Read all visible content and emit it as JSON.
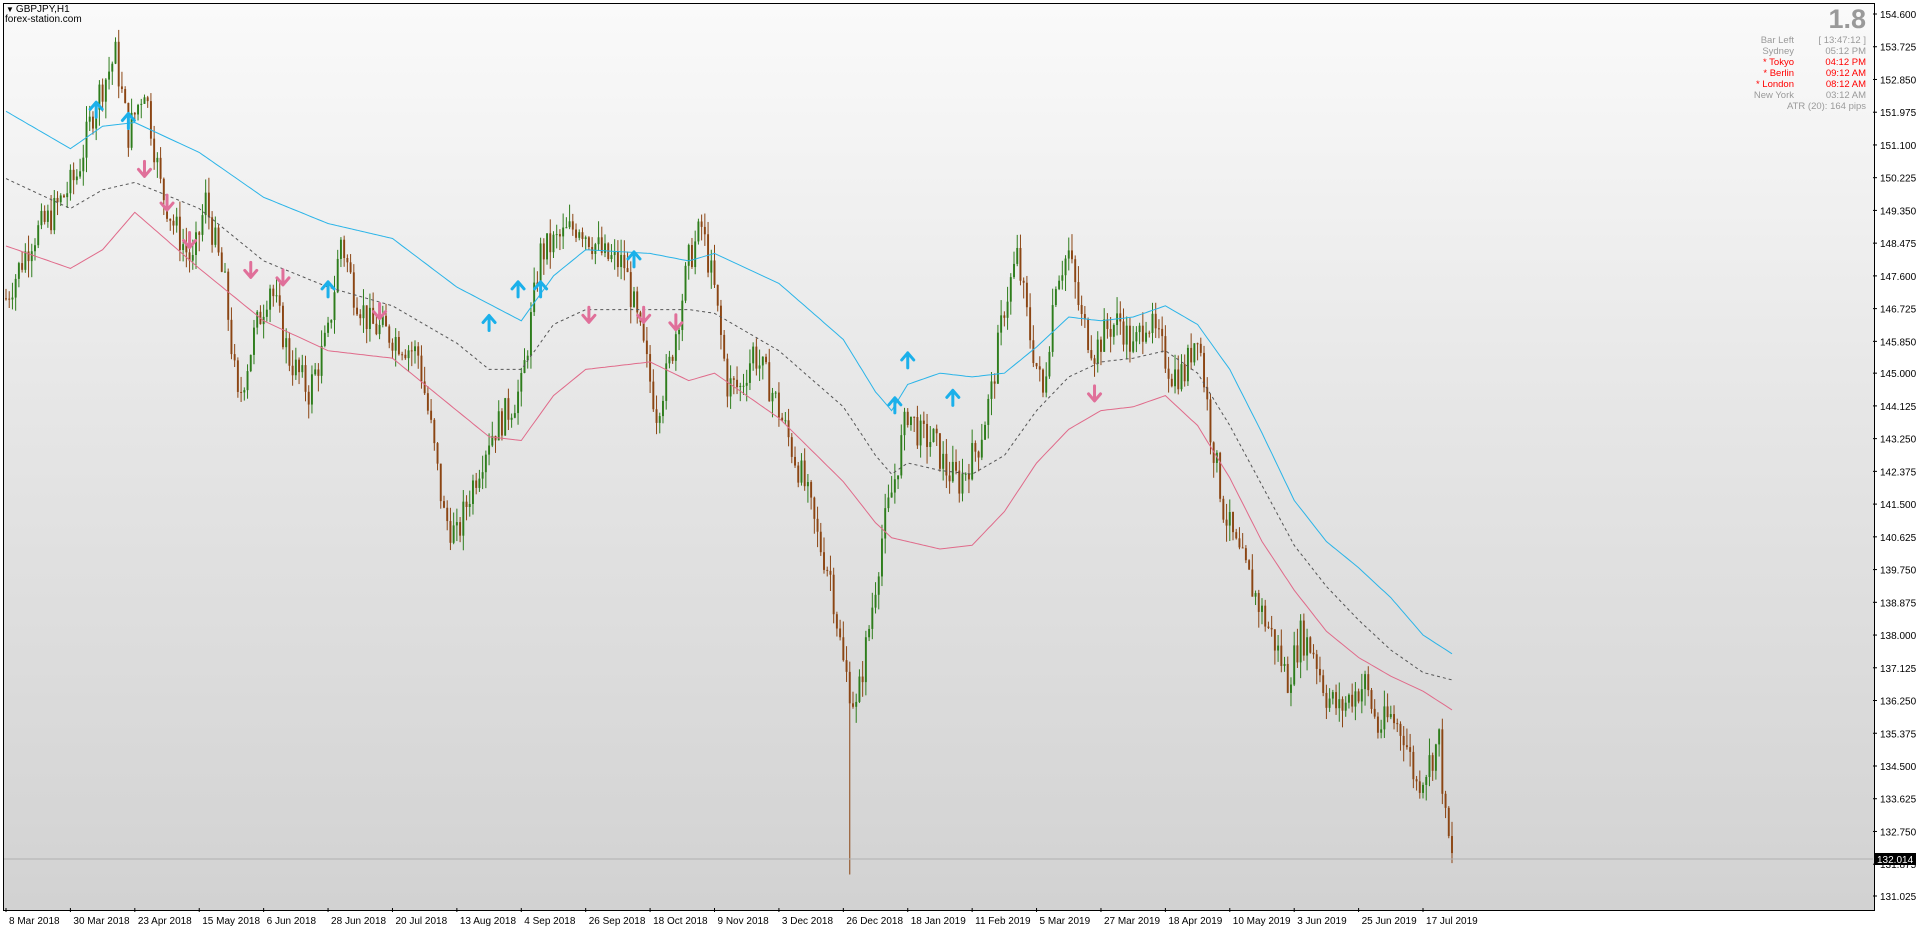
{
  "chart": {
    "symbol": "GBPJPY,H1",
    "watermark": "forex-station.com",
    "current_price": "132.014"
  },
  "info_panel": {
    "spread": "1.8",
    "rows": [
      {
        "label": "Bar Left",
        "value": "[ 13:47:12 ]",
        "color": "#9a9a9a"
      },
      {
        "label": "Sydney",
        "value": "05:12 PM",
        "color": "#9a9a9a"
      },
      {
        "label": "* Tokyo",
        "value": "04:12 PM",
        "color": "#ff0000"
      },
      {
        "label": "* Berlin",
        "value": "09:12 AM",
        "color": "#ff0000"
      },
      {
        "label": "* London",
        "value": "08:12 AM",
        "color": "#ff0000"
      },
      {
        "label": "New York",
        "value": "03:12 AM",
        "color": "#9a9a9a"
      },
      {
        "label": "ATR (20): 164 pips",
        "value": "",
        "color": "#9a9a9a"
      }
    ]
  },
  "chart_data": {
    "type": "candlestick",
    "title": "GBPJPY,H1",
    "ylim": [
      131.025,
      154.6
    ],
    "y_ticks": [
      "154.600",
      "153.725",
      "152.850",
      "151.975",
      "151.100",
      "150.225",
      "149.350",
      "148.475",
      "147.600",
      "146.725",
      "145.850",
      "145.000",
      "144.125",
      "143.250",
      "142.375",
      "141.500",
      "140.625",
      "139.750",
      "138.875",
      "138.000",
      "137.125",
      "136.250",
      "135.375",
      "134.500",
      "133.625",
      "132.750",
      "131.875",
      "131.025"
    ],
    "x_ticks": [
      "8 Mar 2018",
      "30 Mar 2018",
      "23 Apr 2018",
      "15 May 2018",
      "6 Jun 2018",
      "28 Jun 2018",
      "20 Jul 2018",
      "13 Aug 2018",
      "4 Sep 2018",
      "26 Sep 2018",
      "18 Oct 2018",
      "9 Nov 2018",
      "3 Dec 2018",
      "26 Dec 2018",
      "18 Jan 2019",
      "11 Feb 2019",
      "5 Mar 2019",
      "27 Mar 2019",
      "18 Apr 2019",
      "10 May 2019",
      "3 Jun 2019",
      "25 Jun 2019",
      "17 Jul 2019"
    ],
    "x_tick_index": [
      0,
      20,
      40,
      60,
      80,
      100,
      120,
      140,
      160,
      180,
      200,
      220,
      240,
      260,
      280,
      300,
      320,
      340,
      360,
      380,
      400,
      420,
      440
    ],
    "price_path": [
      [
        0,
        147.0
      ],
      [
        8,
        148.6
      ],
      [
        14,
        149.2
      ],
      [
        22,
        150.3
      ],
      [
        28,
        152.3
      ],
      [
        34,
        153.5
      ],
      [
        38,
        151.4
      ],
      [
        43,
        152.7
      ],
      [
        48,
        150.0
      ],
      [
        52,
        149.0
      ],
      [
        58,
        147.9
      ],
      [
        62,
        149.6
      ],
      [
        68,
        147.3
      ],
      [
        72,
        144.2
      ],
      [
        77,
        146.0
      ],
      [
        82,
        147.4
      ],
      [
        88,
        145.4
      ],
      [
        94,
        144.5
      ],
      [
        100,
        146.0
      ],
      [
        104,
        148.6
      ],
      [
        108,
        147.2
      ],
      [
        113,
        146.3
      ],
      [
        120,
        146.0
      ],
      [
        128,
        145.5
      ],
      [
        132,
        143.5
      ],
      [
        136,
        141.2
      ],
      [
        140,
        140.6
      ],
      [
        144,
        141.8
      ],
      [
        150,
        143.3
      ],
      [
        156,
        144.0
      ],
      [
        160,
        144.6
      ],
      [
        166,
        148.2
      ],
      [
        172,
        148.6
      ],
      [
        178,
        149.0
      ],
      [
        186,
        148.1
      ],
      [
        192,
        147.9
      ],
      [
        198,
        145.6
      ],
      [
        202,
        144.0
      ],
      [
        206,
        145.2
      ],
      [
        212,
        148.0
      ],
      [
        216,
        148.9
      ],
      [
        220,
        147.2
      ],
      [
        224,
        144.7
      ],
      [
        228,
        144.6
      ],
      [
        232,
        145.6
      ],
      [
        238,
        144.5
      ],
      [
        244,
        143.0
      ],
      [
        248,
        142.0
      ],
      [
        252,
        140.6
      ],
      [
        256,
        139.6
      ],
      [
        260,
        137.2
      ],
      [
        264,
        136.0
      ],
      [
        268,
        138.2
      ],
      [
        272,
        140.6
      ],
      [
        276,
        142.2
      ],
      [
        280,
        144.0
      ],
      [
        284,
        143.3
      ],
      [
        288,
        143.2
      ],
      [
        292,
        142.4
      ],
      [
        296,
        142.1
      ],
      [
        302,
        143.1
      ],
      [
        306,
        144.5
      ],
      [
        310,
        146.8
      ],
      [
        314,
        148.1
      ],
      [
        318,
        146.0
      ],
      [
        322,
        144.4
      ],
      [
        326,
        147.6
      ],
      [
        330,
        148.2
      ],
      [
        334,
        146.4
      ],
      [
        338,
        145.6
      ],
      [
        342,
        146.2
      ],
      [
        346,
        146.4
      ],
      [
        350,
        145.6
      ],
      [
        354,
        146.5
      ],
      [
        358,
        145.8
      ],
      [
        362,
        145.0
      ],
      [
        366,
        145.0
      ],
      [
        370,
        146.2
      ],
      [
        374,
        143.5
      ],
      [
        378,
        141.4
      ],
      [
        382,
        140.3
      ],
      [
        386,
        139.5
      ],
      [
        390,
        138.6
      ],
      [
        394,
        137.8
      ],
      [
        398,
        136.8
      ],
      [
        402,
        138.0
      ],
      [
        406,
        137.6
      ],
      [
        410,
        136.4
      ],
      [
        414,
        136.0
      ],
      [
        418,
        136.4
      ],
      [
        422,
        136.7
      ],
      [
        426,
        135.5
      ],
      [
        430,
        135.8
      ],
      [
        434,
        135.4
      ],
      [
        438,
        134.0
      ],
      [
        442,
        134.6
      ],
      [
        445,
        135.2
      ],
      [
        447,
        133.0
      ],
      [
        449,
        132.0
      ]
    ],
    "candle_count": 450,
    "band_upper": [
      [
        0,
        152.0
      ],
      [
        20,
        151.0
      ],
      [
        30,
        151.6
      ],
      [
        40,
        151.7
      ],
      [
        60,
        150.9
      ],
      [
        80,
        149.7
      ],
      [
        100,
        149.0
      ],
      [
        120,
        148.6
      ],
      [
        140,
        147.3
      ],
      [
        160,
        146.4
      ],
      [
        170,
        147.6
      ],
      [
        180,
        148.3
      ],
      [
        200,
        148.2
      ],
      [
        212,
        148.0
      ],
      [
        220,
        148.2
      ],
      [
        240,
        147.4
      ],
      [
        260,
        145.9
      ],
      [
        270,
        144.5
      ],
      [
        275,
        144.0
      ],
      [
        280,
        144.7
      ],
      [
        290,
        145.0
      ],
      [
        300,
        144.9
      ],
      [
        310,
        145.0
      ],
      [
        320,
        145.7
      ],
      [
        330,
        146.5
      ],
      [
        340,
        146.4
      ],
      [
        350,
        146.5
      ],
      [
        360,
        146.8
      ],
      [
        370,
        146.3
      ],
      [
        380,
        145.1
      ],
      [
        390,
        143.4
      ],
      [
        400,
        141.6
      ],
      [
        410,
        140.5
      ],
      [
        420,
        139.8
      ],
      [
        430,
        139.0
      ],
      [
        440,
        138.0
      ],
      [
        449,
        137.5
      ]
    ],
    "band_middle": [
      [
        0,
        150.2
      ],
      [
        20,
        149.4
      ],
      [
        30,
        149.9
      ],
      [
        40,
        150.1
      ],
      [
        60,
        149.4
      ],
      [
        80,
        148.0
      ],
      [
        100,
        147.3
      ],
      [
        120,
        146.8
      ],
      [
        140,
        145.8
      ],
      [
        150,
        145.1
      ],
      [
        160,
        145.1
      ],
      [
        170,
        146.3
      ],
      [
        180,
        146.7
      ],
      [
        200,
        146.7
      ],
      [
        212,
        146.7
      ],
      [
        220,
        146.6
      ],
      [
        240,
        145.6
      ],
      [
        260,
        144.1
      ],
      [
        270,
        142.8
      ],
      [
        275,
        142.3
      ],
      [
        280,
        142.6
      ],
      [
        290,
        142.4
      ],
      [
        300,
        142.3
      ],
      [
        310,
        142.8
      ],
      [
        320,
        144.0
      ],
      [
        330,
        144.9
      ],
      [
        340,
        145.3
      ],
      [
        350,
        145.4
      ],
      [
        360,
        145.6
      ],
      [
        370,
        145.0
      ],
      [
        380,
        143.6
      ],
      [
        390,
        142.0
      ],
      [
        400,
        140.4
      ],
      [
        410,
        139.3
      ],
      [
        420,
        138.4
      ],
      [
        430,
        137.6
      ],
      [
        440,
        137.0
      ],
      [
        449,
        136.8
      ]
    ],
    "band_lower": [
      [
        0,
        148.4
      ],
      [
        20,
        147.8
      ],
      [
        30,
        148.3
      ],
      [
        40,
        149.3
      ],
      [
        60,
        147.8
      ],
      [
        80,
        146.4
      ],
      [
        100,
        145.6
      ],
      [
        120,
        145.4
      ],
      [
        140,
        144.0
      ],
      [
        150,
        143.3
      ],
      [
        160,
        143.2
      ],
      [
        170,
        144.4
      ],
      [
        180,
        145.1
      ],
      [
        200,
        145.3
      ],
      [
        212,
        144.8
      ],
      [
        220,
        145.0
      ],
      [
        240,
        143.8
      ],
      [
        260,
        142.1
      ],
      [
        270,
        141.0
      ],
      [
        275,
        140.6
      ],
      [
        280,
        140.5
      ],
      [
        290,
        140.3
      ],
      [
        300,
        140.4
      ],
      [
        310,
        141.3
      ],
      [
        320,
        142.6
      ],
      [
        330,
        143.5
      ],
      [
        340,
        144.0
      ],
      [
        350,
        144.1
      ],
      [
        360,
        144.4
      ],
      [
        370,
        143.6
      ],
      [
        380,
        142.2
      ],
      [
        390,
        140.5
      ],
      [
        400,
        139.2
      ],
      [
        410,
        138.1
      ],
      [
        420,
        137.4
      ],
      [
        430,
        136.9
      ],
      [
        440,
        136.5
      ],
      [
        449,
        136.0
      ]
    ],
    "up_arrows": [
      [
        28,
        152.0
      ],
      [
        38,
        151.7
      ],
      [
        100,
        147.2
      ],
      [
        150,
        146.3
      ],
      [
        159,
        147.2
      ],
      [
        166,
        147.2
      ],
      [
        195,
        148.0
      ],
      [
        276,
        144.1
      ],
      [
        280,
        145.3
      ],
      [
        294,
        144.3
      ]
    ],
    "down_arrows": [
      [
        43,
        150.5
      ],
      [
        50,
        149.6
      ],
      [
        57,
        148.6
      ],
      [
        76,
        147.8
      ],
      [
        86,
        147.6
      ],
      [
        116,
        146.7
      ],
      [
        181,
        146.6
      ],
      [
        198,
        146.6
      ],
      [
        208,
        146.4
      ],
      [
        338,
        144.5
      ]
    ],
    "colors": {
      "bull": "#2e7d1c",
      "bear": "#8b4513",
      "upper_band": "#2ab4e8",
      "middle_band": "#555555",
      "lower_band": "#e06a8a",
      "up_arrow": "#1bb0ea",
      "down_arrow": "#e0709a"
    }
  }
}
